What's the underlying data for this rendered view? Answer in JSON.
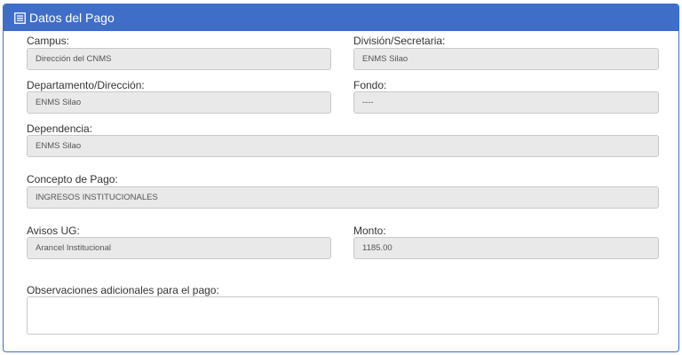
{
  "panel": {
    "title": "Datos del Pago",
    "icon": "list-icon",
    "header_color": "#3f6ec9"
  },
  "fields": {
    "campus": {
      "label": "Campus:",
      "value": "Dirección del CNMS"
    },
    "division": {
      "label": "División/Secretaria:",
      "value": "ENMS Silao"
    },
    "departamento": {
      "label": "Departamento/Dirección:",
      "value": "ENMS Silao"
    },
    "fondo": {
      "label": "Fondo:",
      "value": "----"
    },
    "dependencia": {
      "label": "Dependencia:",
      "value": "ENMS Silao"
    },
    "concepto": {
      "label": "Concepto de Pago:",
      "value": "INGRESOS INSTITUCIONALES"
    },
    "avisos": {
      "label": "Avisos UG:",
      "value": "Arancel Institucional"
    },
    "monto": {
      "label": "Monto:",
      "value": "1185.00"
    },
    "observaciones": {
      "label": "Observaciones adicionales para el pago:",
      "value": ""
    }
  }
}
